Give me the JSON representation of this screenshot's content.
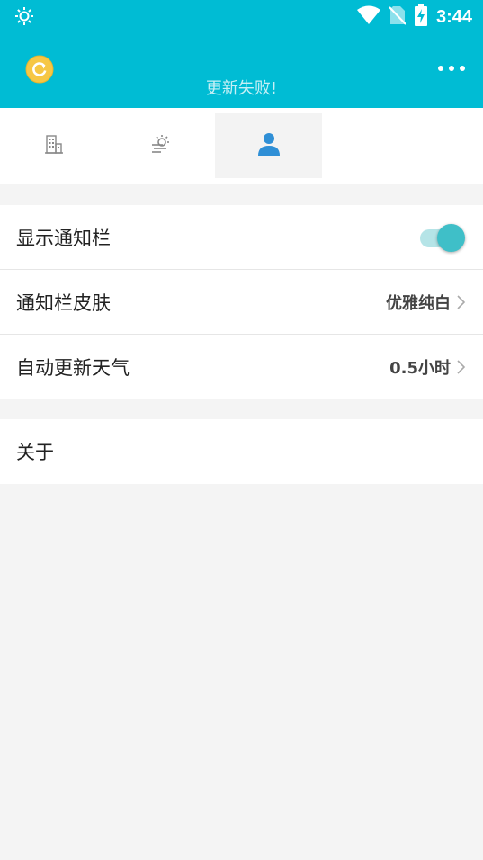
{
  "status_bar": {
    "time": "3:44",
    "left_icon": "brightness-icon",
    "right_icons": [
      "wifi-icon",
      "no-sim-icon",
      "battery-charging-icon"
    ]
  },
  "app_bar": {
    "update_message": "更新失败!",
    "left_icon": "refresh-coin-icon",
    "right_icon": "more-icon"
  },
  "tabs": [
    {
      "icon": "building-icon",
      "active": false
    },
    {
      "icon": "weather-haze-icon",
      "active": false
    },
    {
      "icon": "person-icon",
      "active": true
    }
  ],
  "settings": {
    "show_notification": {
      "label": "显示通知栏",
      "enabled": true
    },
    "notification_skin": {
      "label": "通知栏皮肤",
      "value": "优雅纯白"
    },
    "auto_update": {
      "label": "自动更新天气",
      "value": "0.5小时"
    },
    "about": {
      "label": "关于"
    }
  },
  "colors": {
    "primary": "#00bcd4",
    "toggle_thumb": "#3fbfc8",
    "toggle_track": "#b5e4e7",
    "active_tab_icon": "#2f8fd6",
    "coin": "#f6c745"
  }
}
